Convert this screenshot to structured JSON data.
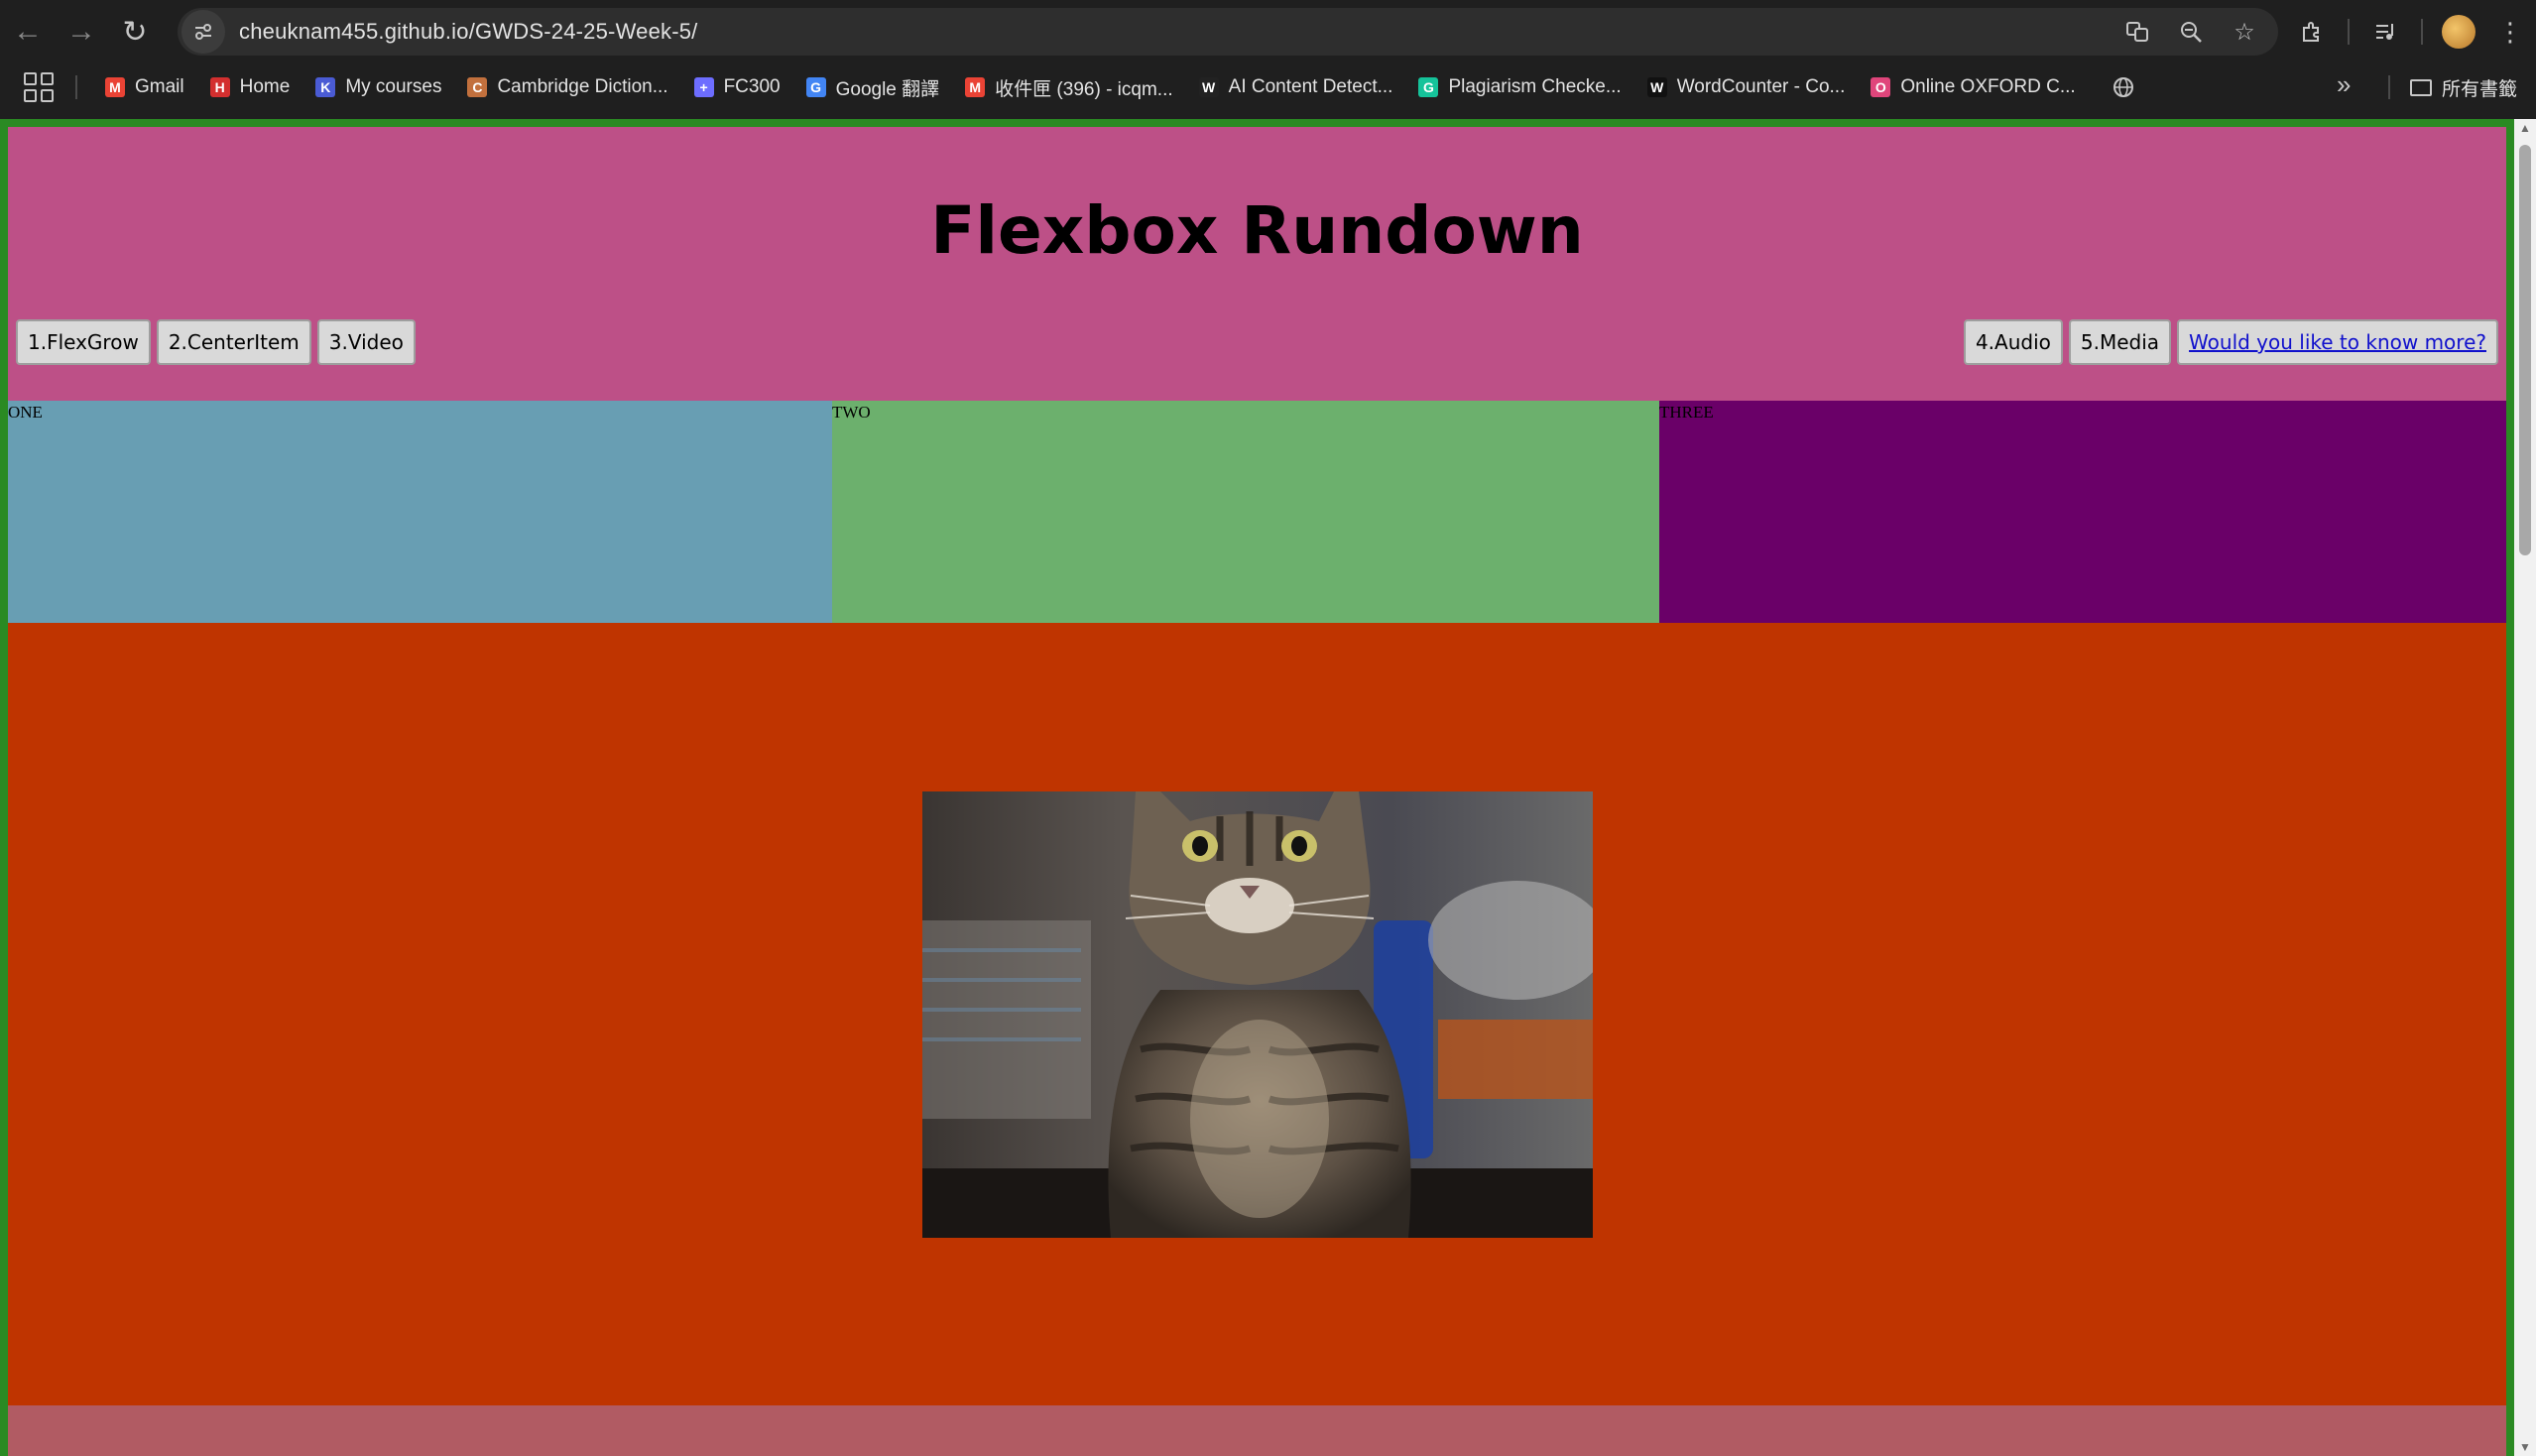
{
  "browser": {
    "url": "cheuknam455.github.io/GWDS-24-25-Week-5/",
    "bookmarks": [
      {
        "label": "Gmail",
        "icon": "gmail-icon",
        "color": "#ea4335",
        "glyph": "M"
      },
      {
        "label": "Home",
        "icon": "home-bookmark-icon",
        "color": "#d32f2f",
        "glyph": "H"
      },
      {
        "label": "My courses",
        "icon": "courses-icon",
        "color": "#4a5bd4",
        "glyph": "K"
      },
      {
        "label": "Cambridge Diction...",
        "icon": "cambridge-icon",
        "color": "#c2703d",
        "glyph": "C"
      },
      {
        "label": "FC300",
        "icon": "fc300-icon",
        "color": "#6d6dff",
        "glyph": "+"
      },
      {
        "label": "Google 翻譯",
        "icon": "google-translate-icon",
        "color": "#4285f4",
        "glyph": "G"
      },
      {
        "label": "收件匣 (396) - icqm...",
        "icon": "inbox-icon",
        "color": "#ea4335",
        "glyph": "M"
      },
      {
        "label": "AI Content Detect...",
        "icon": "ai-detect-icon",
        "color": "#222222",
        "glyph": "W"
      },
      {
        "label": "Plagiarism Checke...",
        "icon": "grammarly-icon",
        "color": "#15c39a",
        "glyph": "G"
      },
      {
        "label": "WordCounter - Co...",
        "icon": "wordcounter-icon",
        "color": "#111111",
        "glyph": "W"
      },
      {
        "label": "Online OXFORD C...",
        "icon": "oxford-icon",
        "color": "#e0457b",
        "glyph": "O"
      }
    ],
    "folder_label": "所有書籤"
  },
  "page": {
    "title": "Flexbox Rundown",
    "nav_left": [
      "1.FlexGrow",
      "2.CenterItem",
      "3.Video"
    ],
    "nav_right": [
      "4.Audio",
      "5.Media"
    ],
    "nav_link": "Would you like to know more?",
    "columns": [
      "ONE",
      "TWO",
      "THREE"
    ],
    "colors": {
      "border": "#2a8a23",
      "header": "#bd5087",
      "col_one": "#689eb3",
      "col_two": "#6cb06d",
      "col_three": "#6a0068",
      "media_bg": "#bf3400",
      "footer": "#b15b63"
    }
  }
}
